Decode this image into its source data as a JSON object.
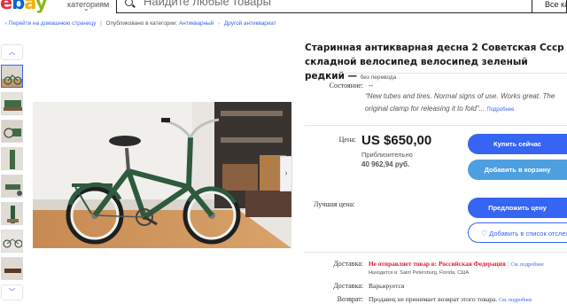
{
  "header": {
    "logo": {
      "e1": "e",
      "b": "b",
      "a": "a",
      "y": "y"
    },
    "category_label": "категориям",
    "search_placeholder": "Найдите любые товары",
    "all_categories": "Все кате"
  },
  "breadcrumb": {
    "back": "Перейти на домашнюю страницу",
    "published_in": "Опубликовано в категории:",
    "cat1": "Антикварный",
    "cat2": "Другой антиквариат"
  },
  "listing": {
    "title": "Старинная антикварная десна 2 Советская Ссср складной велосипед велосипед зеленый редкий —",
    "no_translation": "без перевода",
    "condition_label": "Состояние:",
    "condition_value": "--",
    "condition_quote": "“New tubes and tires. Normal signs of use. Works great. The original clamp for releasing it to fold”...",
    "more_link": "Подробнее",
    "price_label": "Цена:",
    "price": "US $650,00",
    "approx_label": "Приблизительно",
    "approx_value": "40 962,94 руб.",
    "buy_now": "Купить сейчас",
    "add_to_cart": "Добавить в корзину",
    "best_offer_label": "Лучшая цена:",
    "make_offer": "Предложить цену",
    "watchlist": "Добавить в список отслеж",
    "shipping_label": "Доставка:",
    "shipping_value": "Не отправляет товар в: Российская Федерация",
    "shipping_details": "См. подробнее",
    "location": "Находится в: Saint Petersburg, Florida, США",
    "delivery_label": "Доставка:",
    "delivery_value": "Варьируется",
    "returns_label": "Возврат:",
    "returns_value": "Продавец не принимает возврат этого товара.",
    "returns_details": "См. подробнее"
  },
  "gallery": {
    "up_icon": "chevron-up-icon",
    "down_icon": "chevron-down-icon",
    "next_icon": "chevron-right-icon"
  },
  "colors": {
    "accent": "#3665f3",
    "secondary_button": "#4d9fe0",
    "warning": "#dd1e31"
  }
}
